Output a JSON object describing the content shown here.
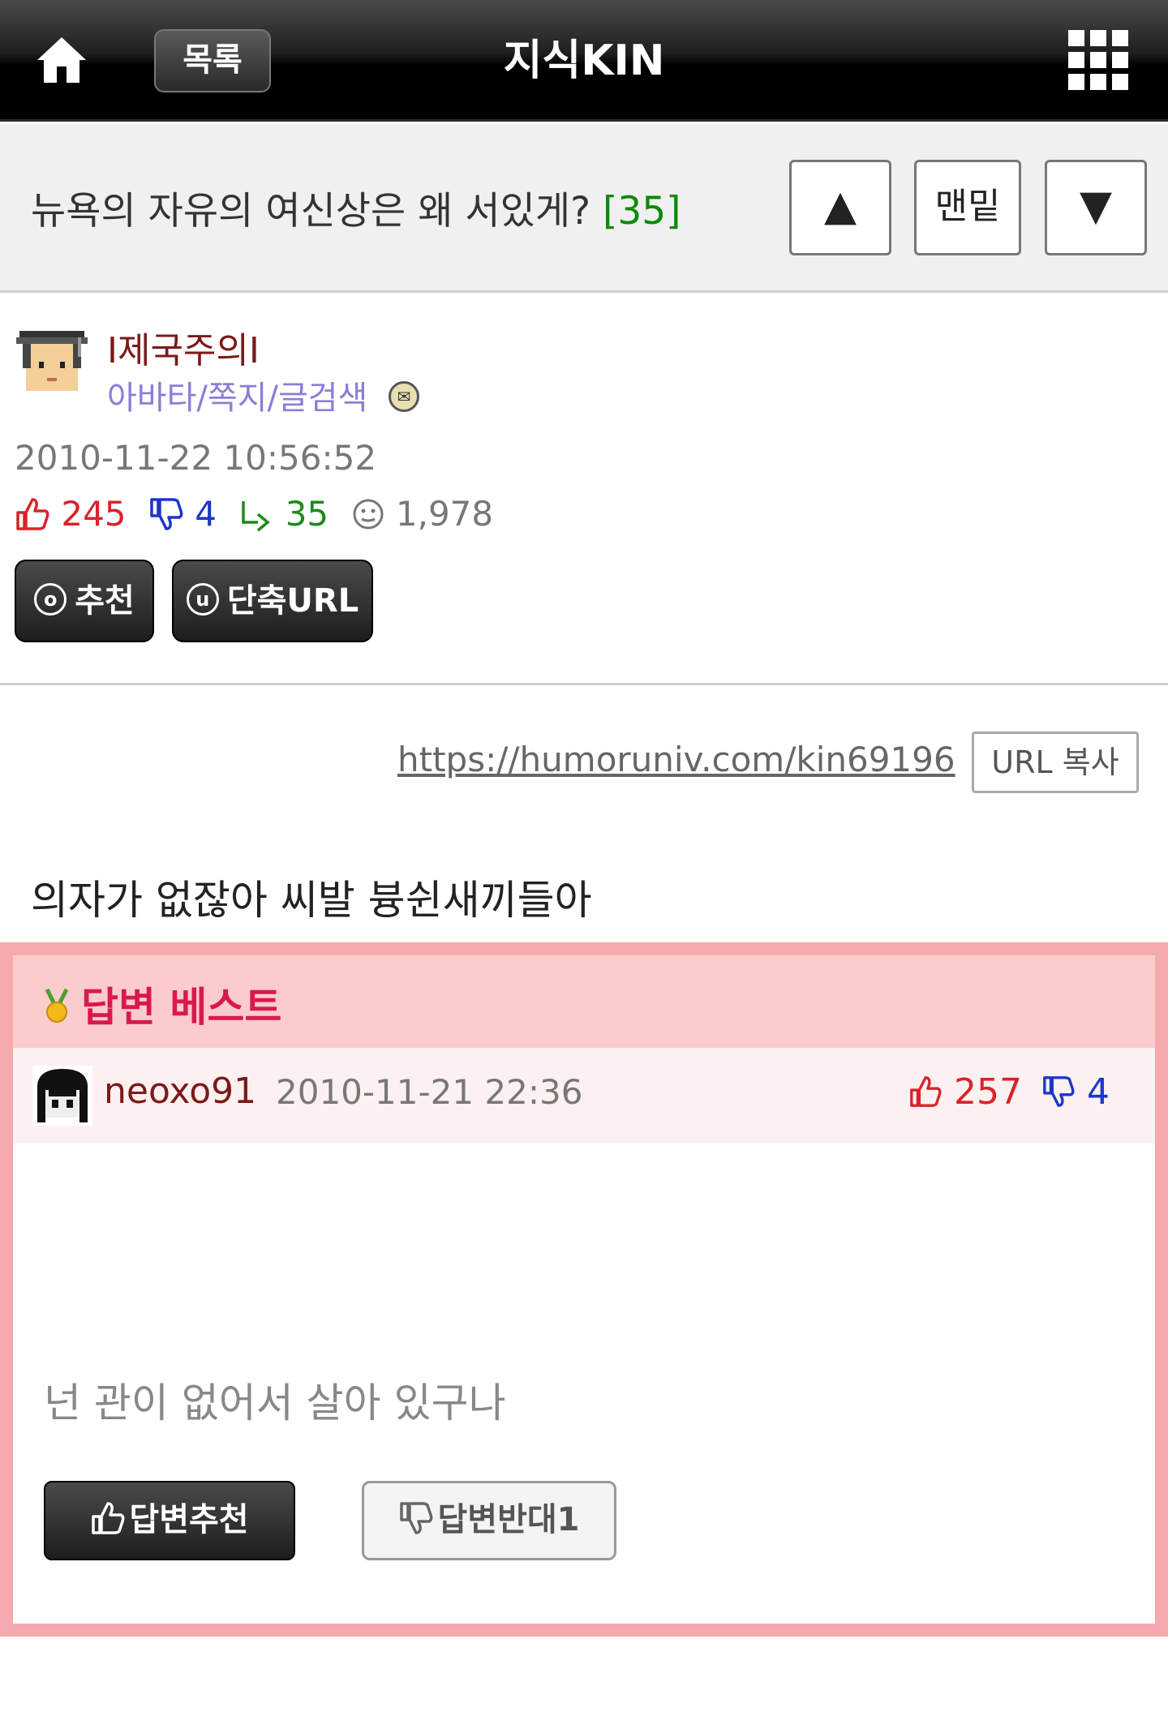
{
  "topbar": {
    "list_label": "목록",
    "title": "지식KIN",
    "home_icon": "home-icon",
    "menu_icon": "grid-menu-icon"
  },
  "post": {
    "title": "뉴욕의 자유의 여신상은 왜 서있게?",
    "answer_count": "[35]",
    "nav": {
      "up": "▲",
      "bottom": "맨밑",
      "down": "▼"
    },
    "author": "I제국주의I",
    "author_links": "아바타/쪽지/글검색",
    "date": "2010-11-22 10:56:52",
    "stats": {
      "likes": "245",
      "dislikes": "4",
      "replies": "35",
      "views": "1,978"
    },
    "recommend_label": "추천",
    "short_url_label": "단축URL",
    "url": "https://humoruniv.com/kin69196",
    "url_copy_label": "URL 복사",
    "body": "의자가 없잖아 씨발 븅쉰새끼들아"
  },
  "best_answer": {
    "header": "답변 베스트",
    "user": "neoxo91",
    "date": "2010-11-21 22:36",
    "likes": "257",
    "dislikes": "4",
    "text": "넌 관이 없어서 살아 있구나",
    "up_label": "답변추천",
    "down_label": "답변반대1"
  },
  "colors": {
    "accent_red": "#d8232a",
    "accent_blue": "#1c36c8",
    "accent_green": "#1b8b1b",
    "best_border": "#f6a9ac",
    "best_header_bg": "#fccccd"
  }
}
